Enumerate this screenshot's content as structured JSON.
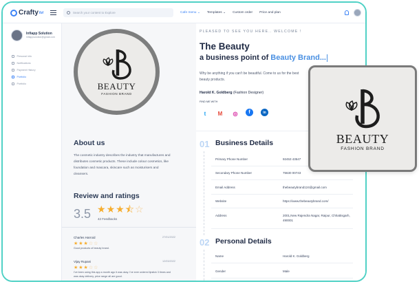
{
  "app": {
    "logo": "Crafty",
    "logo_sub": "fol"
  },
  "search": {
    "placeholder": "Search your content to Explore"
  },
  "nav": [
    "Cafe menu",
    "Templates",
    "Custom order",
    "Price and plan"
  ],
  "user": {
    "name": "Infiapp Solution",
    "email": "infiappsolution@gmail.com"
  },
  "sidebar": {
    "items": [
      "Personal info",
      "Notifications",
      "Payment History",
      "Portfolio",
      "Portfolio"
    ],
    "active_index": 3
  },
  "brand": {
    "name": "BEAUTY",
    "tagline": "FASHION BRAND"
  },
  "about": {
    "title": "About us",
    "text": "The cosmetic industry describes the industry that manufactures and distributes cosmetic products. These include colour cosmetics, like foundation and mascara, skincare such as moisturisers and cleansers."
  },
  "reviews": {
    "title": "Review and ratings",
    "score": "3.5",
    "rating": 3.5,
    "feedback_count": "42 Feedbacks",
    "items": [
      {
        "name": "Charles Harroid",
        "date": "27/01/2022",
        "stars": 3,
        "text": "Good products of beauty brand."
      },
      {
        "name": "Vijay Rupani",
        "date": "12/03/2022",
        "stars": 3,
        "text": "I've been using this app a month ago it was okay. I've ever ordered lipstick 3 times and was okay delivery, price range all are good."
      }
    ]
  },
  "hero": {
    "greeting": "PLEASED TO SEE YOU HERE.. WELCOME !",
    "title": "The Beauty",
    "subtitle_prefix": "a business point of",
    "subtitle_highlight": "Beauty Brand...",
    "description": "Why be anything if you can't be beautiful. Come to us for the best beauty products.",
    "author_name": "Harold K. Goldberg",
    "author_role": "(Fashion Designer)",
    "find_me": "FIND ME WITH"
  },
  "socials": [
    {
      "icon": "twitter-icon",
      "glyph": "t",
      "color": "#1da1f2"
    },
    {
      "icon": "gmail-icon",
      "glyph": "M",
      "color": "#e64a3b"
    },
    {
      "icon": "instagram-icon",
      "glyph": "◎",
      "color": "#d6249f"
    },
    {
      "icon": "facebook-icon",
      "glyph": "f",
      "color": "#1877f2"
    },
    {
      "icon": "linkedin-icon",
      "glyph": "in",
      "color": "#0a66c2"
    }
  ],
  "business": {
    "num": "01",
    "title": "Business Details",
    "rows": [
      {
        "label": "Primary Phone Number",
        "value": "92453 43547"
      },
      {
        "label": "Secondary Phone Number",
        "value": "75630 00743"
      },
      {
        "label": "Email Address",
        "value": "thebeautybrand124@gmail.com"
      },
      {
        "label": "Website",
        "value": "https://www.thebeautybrand.com/"
      },
      {
        "label": "Address",
        "value": "2001,New Rajendra Nagar, Raipur, Chhattisgarh, 490001"
      }
    ]
  },
  "personal": {
    "num": "02",
    "title": "Personal Details",
    "rows": [
      {
        "label": "Name",
        "value": "Harold K. Goldberg"
      },
      {
        "label": "Gender",
        "value": "Male"
      }
    ]
  },
  "colors": {
    "accent": "#3b82f6",
    "frame": "#4fd1c5",
    "star": "#f6ad2e"
  }
}
